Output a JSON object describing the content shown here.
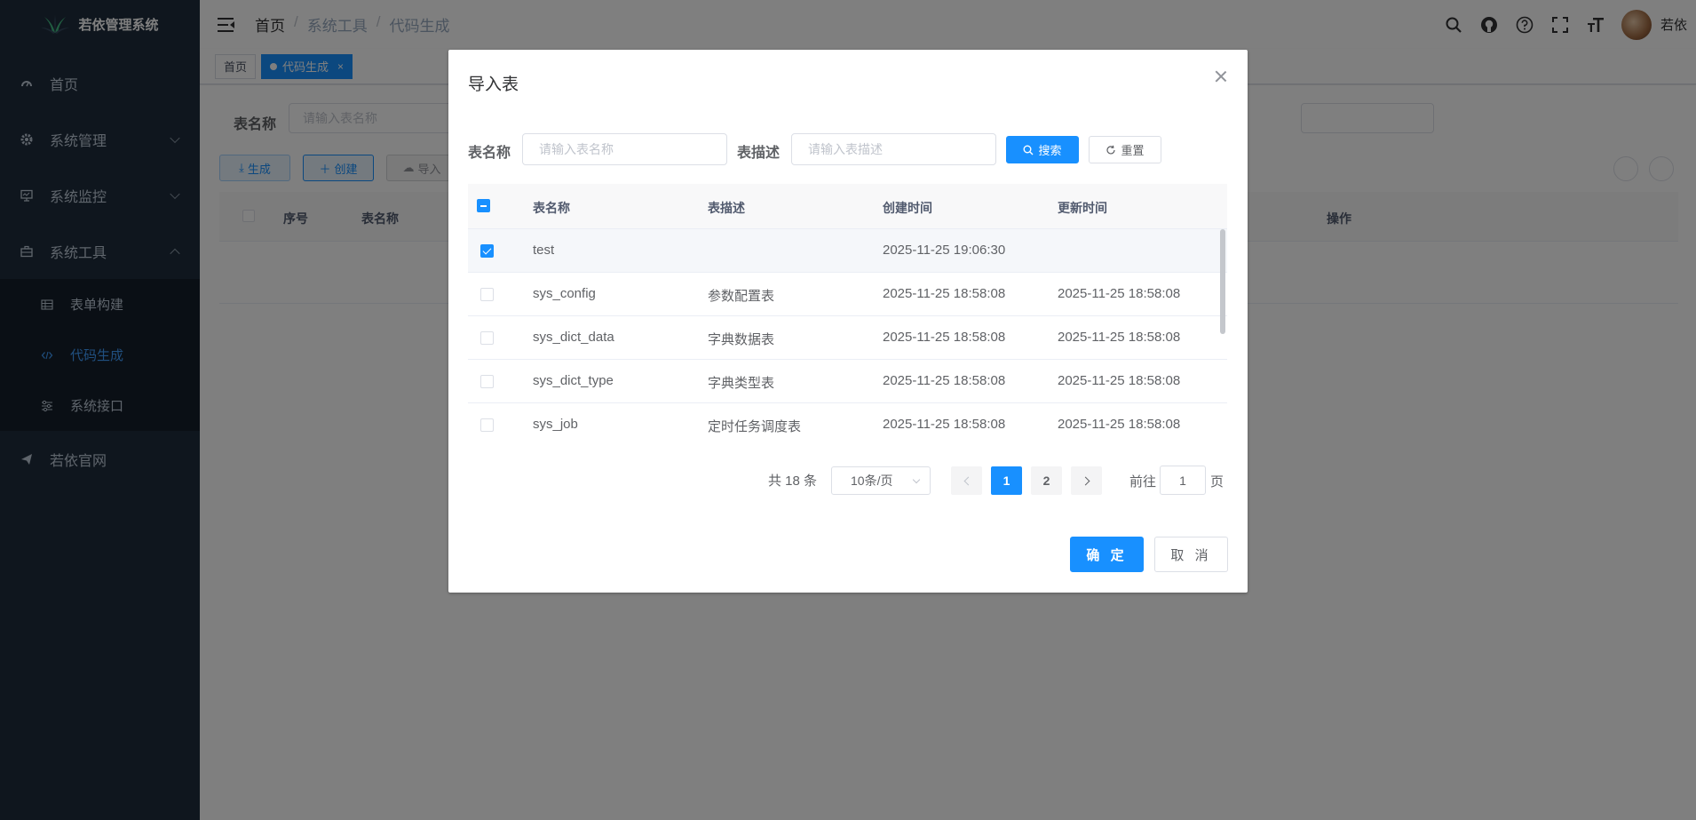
{
  "app": {
    "title": "若依管理系统"
  },
  "colors": {
    "primary": "#1890ff",
    "sidebar_bg": "#1f2d3d",
    "sidebar_text": "#bfcbd9",
    "active": "#409eff"
  },
  "sidebar": {
    "items": [
      {
        "label": "首页",
        "icon": "dashboard-icon"
      },
      {
        "label": "系统管理",
        "icon": "gear-icon"
      },
      {
        "label": "系统监控",
        "icon": "monitor-icon"
      },
      {
        "label": "系统工具",
        "icon": "toolbox-icon"
      }
    ],
    "tools_sub": [
      {
        "label": "表单构建",
        "icon": "table-grid-icon"
      },
      {
        "label": "代码生成",
        "icon": "code-icon"
      },
      {
        "label": "系统接口",
        "icon": "sliders-icon"
      }
    ],
    "website": {
      "label": "若依官网",
      "icon": "send-icon"
    }
  },
  "header": {
    "breadcrumb": [
      "首页",
      "系统工具",
      "代码生成"
    ],
    "username": "若依"
  },
  "tags": [
    {
      "label": "首页"
    },
    {
      "label": "代码生成",
      "close": "×"
    }
  ],
  "bg": {
    "filter_label": "表名称",
    "filter_placeholder": "请输入表名称",
    "buttons": [
      "生成",
      "创建",
      "导入"
    ],
    "columns": {
      "index": "序号",
      "name": "表名称",
      "ops": "操作"
    }
  },
  "dialog": {
    "title": "导入表",
    "filters": {
      "name_label": "表名称",
      "name_placeholder": "请输入表名称",
      "desc_label": "表描述",
      "desc_placeholder": "请输入表描述",
      "search_label": "搜索",
      "reset_label": "重置"
    },
    "table": {
      "columns": {
        "name": "表名称",
        "desc": "表描述",
        "created": "创建时间",
        "updated": "更新时间"
      },
      "rows": [
        {
          "checked": true,
          "name": "test",
          "desc": "",
          "created": "2025-11-25 19:06:30",
          "updated": ""
        },
        {
          "checked": false,
          "name": "sys_config",
          "desc": "参数配置表",
          "created": "2025-11-25 18:58:08",
          "updated": "2025-11-25 18:58:08"
        },
        {
          "checked": false,
          "name": "sys_dict_data",
          "desc": "字典数据表",
          "created": "2025-11-25 18:58:08",
          "updated": "2025-11-25 18:58:08"
        },
        {
          "checked": false,
          "name": "sys_dict_type",
          "desc": "字典类型表",
          "created": "2025-11-25 18:58:08",
          "updated": "2025-11-25 18:58:08"
        },
        {
          "checked": false,
          "name": "sys_job",
          "desc": "定时任务调度表",
          "created": "2025-11-25 18:58:08",
          "updated": "2025-11-25 18:58:08"
        }
      ]
    },
    "pagination": {
      "total": "共 18 条",
      "page_size": "10条/页",
      "pages": [
        "1",
        "2"
      ],
      "current": "1",
      "goto_label": "前往",
      "goto_value": "1",
      "page_suffix": "页"
    },
    "confirm_label": "确 定",
    "cancel_label": "取 消"
  }
}
